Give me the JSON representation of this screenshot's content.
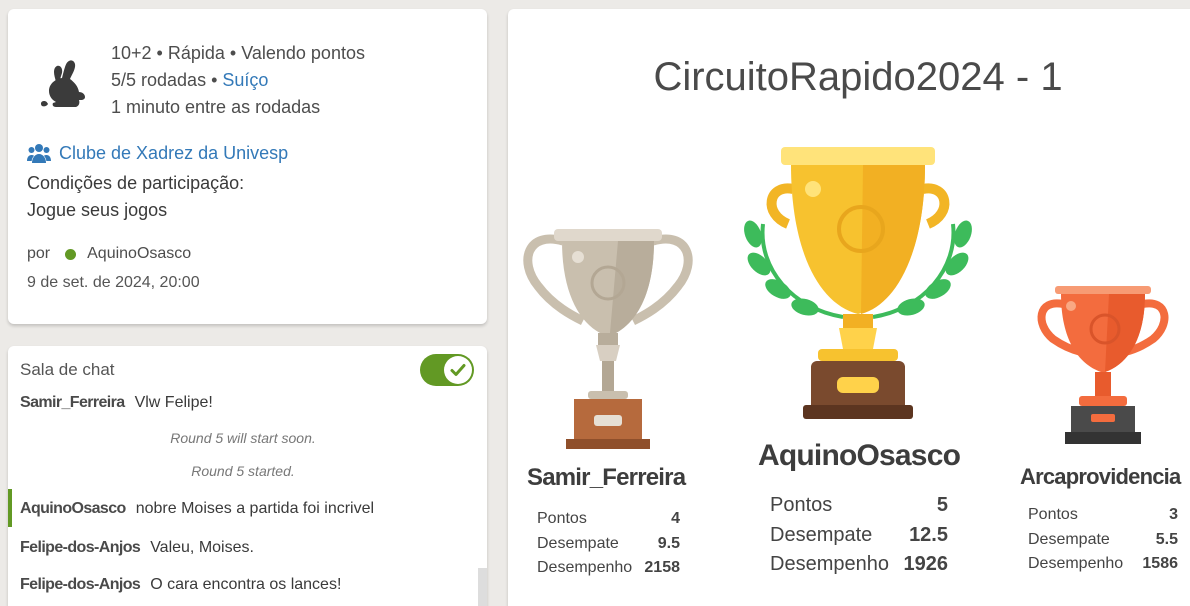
{
  "info": {
    "line1": "10+2 • Rápida • Valendo pontos",
    "line2_prefix": "5/5 rodadas • ",
    "line2_link": "Suíço",
    "line3": "1 minuto entre as rodadas",
    "team": "Clube de Xadrez da Univesp",
    "conditions_title": "Condições de participação:",
    "conditions_value": "Jogue seus jogos",
    "by_label": "por",
    "creator": "AquinoOsasco",
    "date": "9 de set. de 2024, 20:00"
  },
  "chat": {
    "title": "Sala de chat",
    "enabled": true,
    "messages": [
      {
        "user": "Samir_Ferreira",
        "text": "Vlw Felipe!"
      },
      {
        "system": "Round 5 will start soon."
      },
      {
        "system": "Round 5 started."
      },
      {
        "user": "AquinoOsasco",
        "text": "nobre Moises a partida foi incrivel"
      },
      {
        "user": "Felipe-dos-Anjos",
        "text": "Valeu, Moises."
      },
      {
        "user": "Felipe-dos-Anjos",
        "text": "O cara encontra os lances!"
      }
    ]
  },
  "podium": {
    "title": "CircuitoRapido2024 - 1",
    "labels": {
      "points": "Pontos",
      "tiebreak": "Desempate",
      "performance": "Desempenho"
    },
    "first": {
      "name": "AquinoOsasco",
      "points": "5",
      "tiebreak": "12.5",
      "performance": "1926"
    },
    "second": {
      "name": "Samir_Ferreira",
      "points": "4",
      "tiebreak": "9.5",
      "performance": "2158"
    },
    "third": {
      "name": "Arcaprovidencia",
      "points": "3",
      "tiebreak": "5.5",
      "performance": "1586"
    }
  },
  "colors": {
    "accent": "#629924",
    "link": "#3379b8",
    "gold": "#f7c22f",
    "silver": "#c9bfae",
    "bronze": "#f36c3e"
  }
}
